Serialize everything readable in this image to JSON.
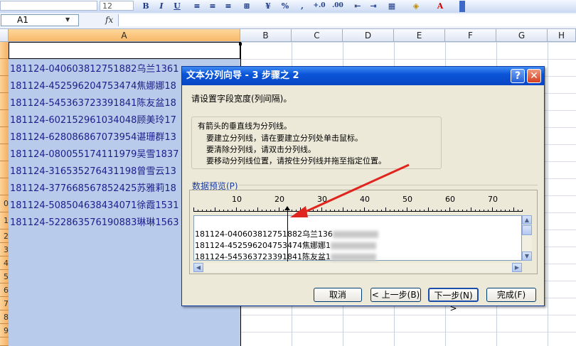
{
  "toolbar": {
    "font_name": "",
    "font_size": "12",
    "bold": "B",
    "italic": "I",
    "underline": "U",
    "percent": "%",
    "comma": ",",
    "inc_decimal": "+.0",
    "dec_decimal": ".00",
    "font_color_letter": "A"
  },
  "formula_bar": {
    "name_box": "A1",
    "fx": "fx",
    "value": ""
  },
  "columns": [
    "A",
    "B",
    "C",
    "D",
    "E",
    "F",
    "G",
    "H"
  ],
  "rows": {
    "selected_numbers": [
      "",
      "",
      "",
      "",
      "",
      "",
      "",
      "",
      "",
      "0",
      "1"
    ],
    "plain_numbers": [
      "2",
      "3",
      "4",
      "5",
      "6",
      "7",
      "8",
      "9",
      ""
    ]
  },
  "cells": [
    "181124-040603812751882乌兰1361",
    "181124-452596204753474焦娜娜18",
    "181124-545363723391841陈友盆18",
    "181124-602152961034048顾美玲17",
    "181124-628086867073954谌珊群13",
    "181124-080055174111979吴雪1837",
    "181124-316535276431198曾雪云13",
    "181124-377668567852425苏雅莉18",
    "181124-508504638434071徐霞1531",
    "181124-522863576190883琳琳1563"
  ],
  "dialog": {
    "title": "文本分列向导 - 3 步骤之 2",
    "help": "?",
    "close": "✕",
    "prompt": "请设置字段宽度(列间隔)。",
    "info_heading": "有箭头的垂直线为分列线。",
    "info_lines": [
      "要建立分列线，请在要建立分列处单击鼠标。",
      "要清除分列线，请双击分列线。",
      "要移动分列线位置，请按住分列线并拖至指定位置。"
    ],
    "preview_label": "数据预览(P)",
    "ruler_labels": [
      "10",
      "20",
      "30",
      "40",
      "50",
      "60",
      "70"
    ],
    "preview_lines": [
      "181124-040603812751882乌兰136",
      "181124-452596204753474焦娜娜1",
      "181124-545363723391841陈友盆1"
    ],
    "buttons": {
      "cancel": "取消",
      "back": "< 上一步(B)",
      "next": "下一步(N) >",
      "finish": "完成(F)"
    }
  },
  "colors": {
    "title_bar": "#0b55d8",
    "annotation_arrow": "#e0251f",
    "selection": "#b9cbeb",
    "row_header_selected": "#f4b062"
  }
}
